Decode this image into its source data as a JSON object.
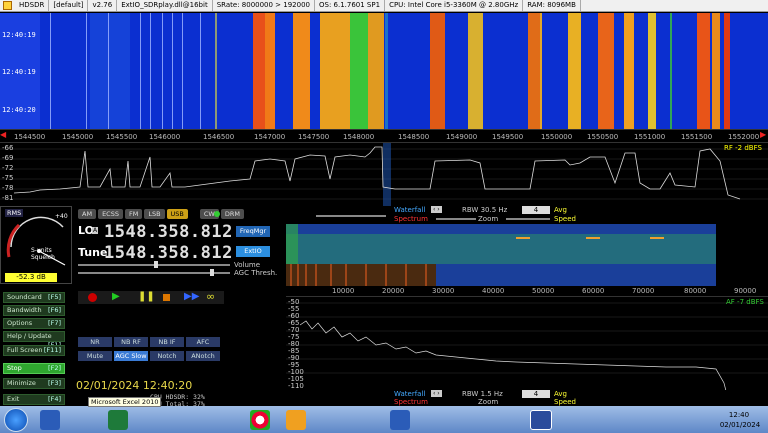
{
  "titlebar": {
    "app": "HDSDR",
    "preset": "[default]",
    "version": "v2.76",
    "extio": "ExtIO_SDRplay.dll@16bit",
    "srate": "SRate: 8000000 > 192000",
    "os": "OS: 6.1.7601 SP1",
    "cpu": "CPU: Intel Core i5-3360M @ 2.80GHz",
    "ram": "RAM: 8096MB"
  },
  "waterfall": {
    "times": [
      "12:40:19",
      "12:40:19",
      "12:40:20"
    ]
  },
  "freq_axis": [
    "1545000",
    "1545500",
    "1546000",
    "1546500",
    "1547000",
    "1547500",
    "1548000",
    "1548500",
    "1549000",
    "1549500",
    "1550000",
    "1550500",
    "1551000",
    "1551500",
    "1552000",
    "1544500"
  ],
  "rf_spectrum": {
    "db_labels": [
      "-66",
      "-69",
      "-72",
      "-75",
      "-78",
      "-81"
    ],
    "status": "RF  -2 dBFS"
  },
  "smeter": {
    "rms": "RMS",
    "scale_plus": "+40",
    "squelch": "S-units\nSquelch",
    "level": "-52.3 dB"
  },
  "modes": [
    "AM",
    "ECSS",
    "FM",
    "LSB",
    "USB",
    "CW",
    "DRM"
  ],
  "lo": {
    "label": "LO",
    "tag": "A",
    "freq": "1548.358.812"
  },
  "tune": {
    "label": "Tune",
    "freq": "1548.358.812"
  },
  "freqmgr": "FreqMgr",
  "extio_btn": "ExtIO",
  "volume": "Volume",
  "agc_thresh": "AGC Thresh.",
  "side_buttons": [
    {
      "label": "Soundcard",
      "key": "[F5]"
    },
    {
      "label": "Bandwidth",
      "key": "[F6]"
    },
    {
      "label": "Options",
      "key": "[F7]"
    },
    {
      "label": "Help / Update",
      "key": "[F1]"
    },
    {
      "label": "Full Screen",
      "key": "[F11]"
    },
    {
      "label": "Stop",
      "key": "[F2]"
    },
    {
      "label": "Minimize",
      "key": "[F3]"
    },
    {
      "label": "Exit",
      "key": "[F4]"
    }
  ],
  "dsp_row1": [
    "NR",
    "NB RF",
    "NB IF",
    "AFC"
  ],
  "dsp_row2": [
    "Mute",
    "AGC Slow",
    "Notch",
    "ANotch"
  ],
  "datetime": "02/01/2024 12:40:20",
  "cpu": {
    "hdsdr": "CPU HDSDR: 32%",
    "total": "CPU Total: 37%"
  },
  "tooltip": "Microsoft Excel 2010",
  "wf_ctrl_top": {
    "waterfall": "Waterfall",
    "rbw": "RBW  30.5 Hz",
    "avg_val": "4",
    "avg": "Avg",
    "spectrum": "Spectrum",
    "zoom": "Zoom",
    "speed": "Speed"
  },
  "af_axis": [
    "10000",
    "20000",
    "30000",
    "40000",
    "50000",
    "60000",
    "70000",
    "80000",
    "90000"
  ],
  "af_spectrum": {
    "db_labels": [
      "-50",
      "-55",
      "-60",
      "-65",
      "-70",
      "-75",
      "-80",
      "-85",
      "-90",
      "-95",
      "-100",
      "-105",
      "-110"
    ],
    "status": "AF  -7 dBFS"
  },
  "wf_ctrl_bottom": {
    "waterfall": "Waterfall",
    "rbw": "RBW  1.5 Hz",
    "avg_val": "4",
    "avg": "Avg",
    "spectrum": "Spectrum",
    "zoom": "Zoom",
    "speed": "Speed"
  },
  "clock": {
    "time": "12:40",
    "date": "02/01/2024"
  }
}
